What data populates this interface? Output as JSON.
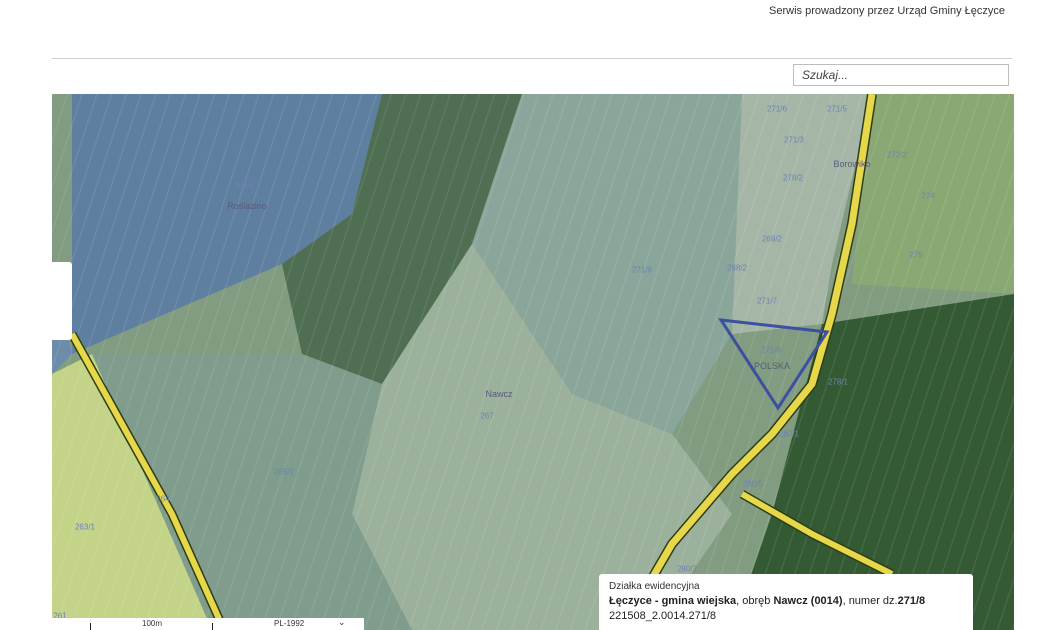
{
  "header": {
    "note": "Serwis prowadzony przez Urząd Gminy Łęczyce"
  },
  "search": {
    "placeholder": "Szukaj..."
  },
  "map": {
    "labels": {
      "roslazino": "Roślazino",
      "nawcz": "Nawcz",
      "borowiko": "Borowiko",
      "polska": "POLSKA",
      "p303_4": "303/4",
      "p267": "267",
      "p271_9": "271/9",
      "p271_7": "271/7",
      "p271_8": "271/8",
      "p271_6": "271/6",
      "p271_5": "271/5",
      "p271_3": "271/3",
      "p272_2": "272/2",
      "p274": "274",
      "p275": "275",
      "p278_2": "278/2",
      "p269_2": "269/2",
      "p268_2": "268/2",
      "p278_1": "278/1",
      "p280_1": "280/1",
      "p280_5": "280/5",
      "p280_2": "280/2",
      "p265_1": "265/1",
      "p264": "264",
      "p263_1": "263/1",
      "p261": "261"
    },
    "selected_parcel_outline_color": "#3d4fa0",
    "road_color": "#e6d84a"
  },
  "scale": {
    "text": "100m",
    "crs": "PL-1992",
    "chevron": "⌄"
  },
  "info": {
    "title": "Działka ewidencyjna",
    "gmina": "Łęczyce - gmina wiejska",
    "obreb_prefix": ", obręb ",
    "obreb": "Nawcz (0014)",
    "numer_prefix": ", numer dz.",
    "numer": "271/8",
    "id": "221508_2.0014.271/8"
  }
}
